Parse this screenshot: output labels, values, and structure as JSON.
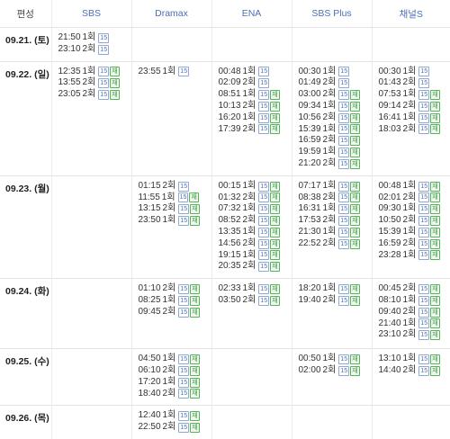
{
  "header": {
    "col0": "편성",
    "channels": [
      "SBS",
      "Dramax",
      "ENA",
      "SBS Plus",
      "채널S"
    ]
  },
  "colors": {
    "header_text": "#4a6fb5",
    "age_badge": "#4a6fb5",
    "rerun_badge": "#3c9a3f"
  },
  "badges": {
    "age": "15",
    "rerun": "재"
  },
  "rows": [
    {
      "date": "09.21. (토)",
      "cells": [
        [
          {
            "time": "21:50",
            "ep": "1회",
            "age": "15",
            "re": ""
          },
          {
            "time": "23:10",
            "ep": "2회",
            "age": "15",
            "re": ""
          }
        ],
        [],
        [],
        [],
        []
      ]
    },
    {
      "date": "09.22. (일)",
      "cells": [
        [
          {
            "time": "12:35",
            "ep": "1회",
            "age": "15",
            "re": "재"
          },
          {
            "time": "13:55",
            "ep": "2회",
            "age": "15",
            "re": "재"
          },
          {
            "time": "23:05",
            "ep": "2회",
            "age": "15",
            "re": "재"
          }
        ],
        [
          {
            "time": "23:55",
            "ep": "1회",
            "age": "15",
            "re": ""
          }
        ],
        [
          {
            "time": "00:48",
            "ep": "1회",
            "age": "15",
            "re": ""
          },
          {
            "time": "02:09",
            "ep": "2회",
            "age": "15",
            "re": ""
          },
          {
            "time": "08:51",
            "ep": "1회",
            "age": "15",
            "re": "재"
          },
          {
            "time": "10:13",
            "ep": "2회",
            "age": "15",
            "re": "재"
          },
          {
            "time": "16:20",
            "ep": "1회",
            "age": "15",
            "re": "재"
          },
          {
            "time": "17:39",
            "ep": "2회",
            "age": "15",
            "re": "재"
          }
        ],
        [
          {
            "time": "00:30",
            "ep": "1회",
            "age": "15",
            "re": ""
          },
          {
            "time": "01:49",
            "ep": "2회",
            "age": "15",
            "re": ""
          },
          {
            "time": "03:00",
            "ep": "2회",
            "age": "15",
            "re": "재"
          },
          {
            "time": "09:34",
            "ep": "1회",
            "age": "15",
            "re": "재"
          },
          {
            "time": "10:56",
            "ep": "2회",
            "age": "15",
            "re": "재"
          },
          {
            "time": "15:39",
            "ep": "1회",
            "age": "15",
            "re": "재"
          },
          {
            "time": "16:59",
            "ep": "2회",
            "age": "15",
            "re": "재"
          },
          {
            "time": "19:59",
            "ep": "1회",
            "age": "15",
            "re": "재"
          },
          {
            "time": "21:20",
            "ep": "2회",
            "age": "15",
            "re": "재"
          }
        ],
        [
          {
            "time": "00:30",
            "ep": "1회",
            "age": "15",
            "re": ""
          },
          {
            "time": "01:43",
            "ep": "2회",
            "age": "15",
            "re": ""
          },
          {
            "time": "07:53",
            "ep": "1회",
            "age": "15",
            "re": "재"
          },
          {
            "time": "09:14",
            "ep": "2회",
            "age": "15",
            "re": "재"
          },
          {
            "time": "16:41",
            "ep": "1회",
            "age": "15",
            "re": "재"
          },
          {
            "time": "18:03",
            "ep": "2회",
            "age": "15",
            "re": "재"
          }
        ]
      ]
    },
    {
      "date": "09.23. (월)",
      "cells": [
        [],
        [
          {
            "time": "01:15",
            "ep": "2회",
            "age": "15",
            "re": ""
          },
          {
            "time": "11:55",
            "ep": "1회",
            "age": "15",
            "re": "재"
          },
          {
            "time": "13:15",
            "ep": "2회",
            "age": "15",
            "re": "재"
          },
          {
            "time": "23:50",
            "ep": "1회",
            "age": "15",
            "re": "재"
          }
        ],
        [
          {
            "time": "00:15",
            "ep": "1회",
            "age": "15",
            "re": "재"
          },
          {
            "time": "01:32",
            "ep": "2회",
            "age": "15",
            "re": "재"
          },
          {
            "time": "07:32",
            "ep": "1회",
            "age": "15",
            "re": "재"
          },
          {
            "time": "08:52",
            "ep": "2회",
            "age": "15",
            "re": "재"
          },
          {
            "time": "13:35",
            "ep": "1회",
            "age": "15",
            "re": "재"
          },
          {
            "time": "14:56",
            "ep": "2회",
            "age": "15",
            "re": "재"
          },
          {
            "time": "19:15",
            "ep": "1회",
            "age": "15",
            "re": "재"
          },
          {
            "time": "20:35",
            "ep": "2회",
            "age": "15",
            "re": "재"
          }
        ],
        [
          {
            "time": "07:17",
            "ep": "1회",
            "age": "15",
            "re": "재"
          },
          {
            "time": "08:38",
            "ep": "2회",
            "age": "15",
            "re": "재"
          },
          {
            "time": "16:31",
            "ep": "1회",
            "age": "15",
            "re": "재"
          },
          {
            "time": "17:53",
            "ep": "2회",
            "age": "15",
            "re": "재"
          },
          {
            "time": "21:30",
            "ep": "1회",
            "age": "15",
            "re": "재"
          },
          {
            "time": "22:52",
            "ep": "2회",
            "age": "15",
            "re": "재"
          }
        ],
        [
          {
            "time": "00:48",
            "ep": "1회",
            "age": "15",
            "re": "재"
          },
          {
            "time": "02:01",
            "ep": "2회",
            "age": "15",
            "re": "재"
          },
          {
            "time": "09:30",
            "ep": "1회",
            "age": "15",
            "re": "재"
          },
          {
            "time": "10:50",
            "ep": "2회",
            "age": "15",
            "re": "재"
          },
          {
            "time": "15:39",
            "ep": "1회",
            "age": "15",
            "re": "재"
          },
          {
            "time": "16:59",
            "ep": "2회",
            "age": "15",
            "re": "재"
          },
          {
            "time": "23:28",
            "ep": "1회",
            "age": "15",
            "re": "재"
          }
        ]
      ]
    },
    {
      "date": "09.24. (화)",
      "cells": [
        [],
        [
          {
            "time": "01:10",
            "ep": "2회",
            "age": "15",
            "re": "재"
          },
          {
            "time": "08:25",
            "ep": "1회",
            "age": "15",
            "re": "재"
          },
          {
            "time": "09:45",
            "ep": "2회",
            "age": "15",
            "re": "재"
          }
        ],
        [
          {
            "time": "02:33",
            "ep": "1회",
            "age": "15",
            "re": "재"
          },
          {
            "time": "03:50",
            "ep": "2회",
            "age": "15",
            "re": "재"
          }
        ],
        [
          {
            "time": "18:20",
            "ep": "1회",
            "age": "15",
            "re": "재"
          },
          {
            "time": "19:40",
            "ep": "2회",
            "age": "15",
            "re": "재"
          }
        ],
        [
          {
            "time": "00:45",
            "ep": "2회",
            "age": "15",
            "re": "재"
          },
          {
            "time": "08:10",
            "ep": "1회",
            "age": "15",
            "re": "재"
          },
          {
            "time": "09:40",
            "ep": "2회",
            "age": "15",
            "re": "재"
          },
          {
            "time": "21:40",
            "ep": "1회",
            "age": "15",
            "re": "재"
          },
          {
            "time": "23:10",
            "ep": "2회",
            "age": "15",
            "re": "재"
          }
        ]
      ]
    },
    {
      "date": "09.25. (수)",
      "cells": [
        [],
        [
          {
            "time": "04:50",
            "ep": "1회",
            "age": "15",
            "re": "재"
          },
          {
            "time": "06:10",
            "ep": "2회",
            "age": "15",
            "re": "재"
          },
          {
            "time": "17:20",
            "ep": "1회",
            "age": "15",
            "re": "재"
          },
          {
            "time": "18:40",
            "ep": "2회",
            "age": "15",
            "re": "재"
          }
        ],
        [],
        [
          {
            "time": "00:50",
            "ep": "1회",
            "age": "15",
            "re": "재"
          },
          {
            "time": "02:00",
            "ep": "2회",
            "age": "15",
            "re": "재"
          }
        ],
        [
          {
            "time": "13:10",
            "ep": "1회",
            "age": "15",
            "re": "재"
          },
          {
            "time": "14:40",
            "ep": "2회",
            "age": "15",
            "re": "재"
          }
        ]
      ]
    },
    {
      "date": "09.26. (목)",
      "cells": [
        [],
        [
          {
            "time": "12:40",
            "ep": "1회",
            "age": "15",
            "re": "재"
          },
          {
            "time": "22:50",
            "ep": "2회",
            "age": "15",
            "re": "재"
          }
        ],
        [],
        [],
        []
      ]
    }
  ]
}
